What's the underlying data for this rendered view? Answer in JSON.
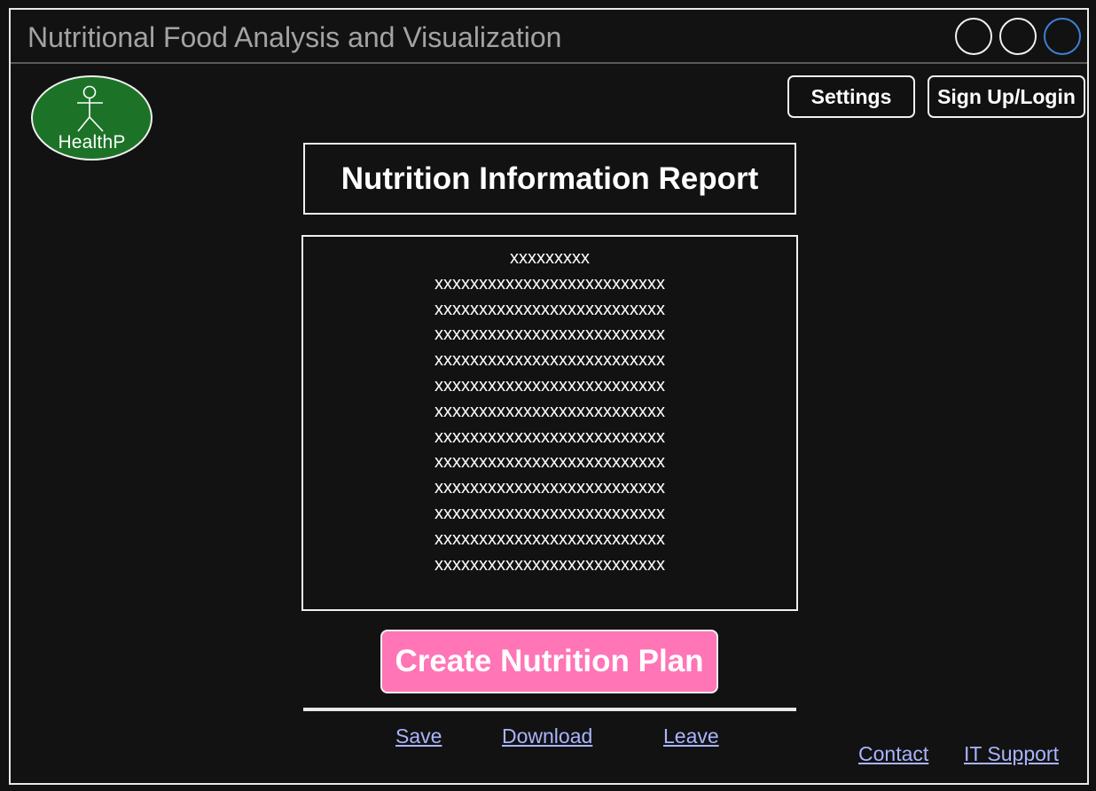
{
  "window": {
    "title": "Nutritional Food Analysis and Visualization",
    "controls": [
      "circle",
      "circle",
      "circle-accent"
    ],
    "accent_color": "#3d7fd6"
  },
  "logo": {
    "text": "HealthP",
    "icon": "stick-figure-icon",
    "color": "#1c7327"
  },
  "header": {
    "settings_label": "Settings",
    "signup_label": "Sign Up/Login"
  },
  "report": {
    "title": "Nutrition Information Report",
    "lines": [
      "xxxxxxxxx",
      "xxxxxxxxxxxxxxxxxxxxxxxxxx",
      "xxxxxxxxxxxxxxxxxxxxxxxxxx",
      "xxxxxxxxxxxxxxxxxxxxxxxxxx",
      "xxxxxxxxxxxxxxxxxxxxxxxxxx",
      "xxxxxxxxxxxxxxxxxxxxxxxxxx",
      "xxxxxxxxxxxxxxxxxxxxxxxxxx",
      "xxxxxxxxxxxxxxxxxxxxxxxxxx",
      "xxxxxxxxxxxxxxxxxxxxxxxxxx",
      "xxxxxxxxxxxxxxxxxxxxxxxxxx",
      "xxxxxxxxxxxxxxxxxxxxxxxxxx",
      "xxxxxxxxxxxxxxxxxxxxxxxxxx",
      "xxxxxxxxxxxxxxxxxxxxxxxxxx"
    ]
  },
  "actions": {
    "create_plan_label": "Create Nutrition Plan",
    "create_plan_color": "#ff75b6"
  },
  "footer": {
    "save_label": "Save",
    "download_label": "Download",
    "leave_label": "Leave",
    "contact_label": "Contact",
    "it_support_label": "IT Support",
    "link_color": "#a9b4ff"
  }
}
